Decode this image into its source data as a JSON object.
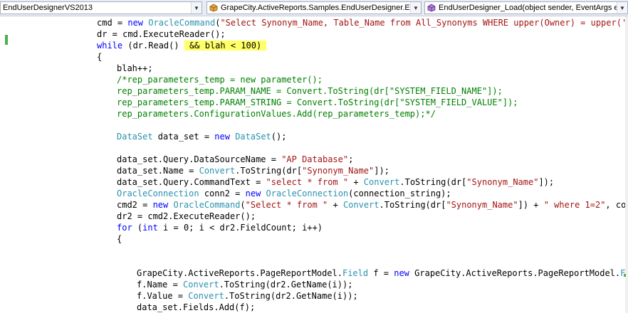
{
  "navigation_bar": {
    "project": "EndUserDesignerVS2013",
    "type": "GrapeCity.ActiveReports.Samples.EndUserDesigner.En",
    "member": "EndUserDesigner_Load(object sender, EventArgs e)"
  },
  "colors": {
    "keyword": "#0000ff",
    "type": "#2b91af",
    "string": "#a31515",
    "comment": "#008000",
    "highlight": "#ffff66",
    "change_marker": "#4cb050"
  },
  "icons": [
    "class-icon",
    "method-icon",
    "chevron-down-icon"
  ],
  "code_lines": [
    {
      "indent": 0,
      "tokens": [
        {
          "t": "cmd = "
        },
        {
          "t": "new",
          "c": "kw"
        },
        {
          "t": " "
        },
        {
          "t": "OracleCommand",
          "c": "ty"
        },
        {
          "t": "("
        },
        {
          "t": "\"Select Synonym_Name, Table_Name from All_Synonyms WHERE upper(Owner) = upper('\"",
          "c": "st"
        },
        {
          "t": " +"
        }
      ]
    },
    {
      "indent": 0,
      "tokens": [
        {
          "t": "dr = cmd.ExecuteReader();"
        }
      ]
    },
    {
      "indent": 0,
      "tokens": [
        {
          "t": "while",
          "c": "kw"
        },
        {
          "t": " (dr.Read() "
        },
        {
          "t": " && blah < 100) ",
          "c": "hl"
        }
      ]
    },
    {
      "indent": 0,
      "tokens": [
        {
          "t": "{"
        }
      ]
    },
    {
      "indent": 1,
      "tokens": [
        {
          "t": "blah++;"
        }
      ]
    },
    {
      "indent": 1,
      "tokens": [
        {
          "t": "/*rep_parameters_temp = new parameter();",
          "c": "cm"
        }
      ]
    },
    {
      "indent": 1,
      "tokens": [
        {
          "t": "rep_parameters_temp.PARAM_NAME = Convert.ToString(dr[\"SYSTEM_FIELD_NAME\"]);",
          "c": "cm"
        }
      ]
    },
    {
      "indent": 1,
      "tokens": [
        {
          "t": "rep_parameters_temp.PARAM_STRING = Convert.ToString(dr[\"SYSTEM_FIELD_VALUE\"]);",
          "c": "cm"
        }
      ]
    },
    {
      "indent": 1,
      "tokens": [
        {
          "t": "rep_parameters.ConfigurationValues.Add(rep_parameters_temp);*/",
          "c": "cm"
        }
      ]
    },
    {
      "indent": 1,
      "tokens": []
    },
    {
      "indent": 1,
      "tokens": [
        {
          "t": "DataSet",
          "c": "ty"
        },
        {
          "t": " data_set = "
        },
        {
          "t": "new",
          "c": "kw"
        },
        {
          "t": " "
        },
        {
          "t": "DataSet",
          "c": "ty"
        },
        {
          "t": "();"
        }
      ]
    },
    {
      "indent": 1,
      "tokens": []
    },
    {
      "indent": 1,
      "tokens": [
        {
          "t": "data_set.Query.DataSourceName = "
        },
        {
          "t": "\"AP Database\"",
          "c": "st"
        },
        {
          "t": ";"
        }
      ]
    },
    {
      "indent": 1,
      "tokens": [
        {
          "t": "data_set.Name = "
        },
        {
          "t": "Convert",
          "c": "ty"
        },
        {
          "t": ".ToString(dr["
        },
        {
          "t": "\"Synonym_Name\"",
          "c": "st"
        },
        {
          "t": "]);"
        }
      ]
    },
    {
      "indent": 1,
      "tokens": [
        {
          "t": "data_set.Query.CommandText = "
        },
        {
          "t": "\"select * from \"",
          "c": "st"
        },
        {
          "t": " + "
        },
        {
          "t": "Convert",
          "c": "ty"
        },
        {
          "t": ".ToString(dr["
        },
        {
          "t": "\"Synonym_Name\"",
          "c": "st"
        },
        {
          "t": "]);"
        }
      ]
    },
    {
      "indent": 1,
      "tokens": [
        {
          "t": "OracleConnection",
          "c": "ty"
        },
        {
          "t": " conn2 = "
        },
        {
          "t": "new",
          "c": "kw"
        },
        {
          "t": " "
        },
        {
          "t": "OracleConnection",
          "c": "ty"
        },
        {
          "t": "(connection_string);"
        }
      ]
    },
    {
      "indent": 1,
      "tokens": [
        {
          "t": "cmd2 = "
        },
        {
          "t": "new",
          "c": "kw"
        },
        {
          "t": " "
        },
        {
          "t": "OracleCommand",
          "c": "ty"
        },
        {
          "t": "("
        },
        {
          "t": "\"Select * from \"",
          "c": "st"
        },
        {
          "t": " + "
        },
        {
          "t": "Convert",
          "c": "ty"
        },
        {
          "t": ".ToString(dr["
        },
        {
          "t": "\"Synonym_Name\"",
          "c": "st"
        },
        {
          "t": "]) + "
        },
        {
          "t": "\" where 1=2\"",
          "c": "st"
        },
        {
          "t": ", conn)"
        }
      ]
    },
    {
      "indent": 1,
      "tokens": [
        {
          "t": "dr2 = cmd2.ExecuteReader();"
        }
      ]
    },
    {
      "indent": 1,
      "tokens": [
        {
          "t": "for",
          "c": "kw"
        },
        {
          "t": " ("
        },
        {
          "t": "int",
          "c": "kw"
        },
        {
          "t": " i = 0; i < dr2.FieldCount; i++)"
        }
      ]
    },
    {
      "indent": 1,
      "tokens": [
        {
          "t": "{"
        }
      ]
    },
    {
      "indent": 1,
      "tokens": []
    },
    {
      "indent": 1,
      "tokens": []
    },
    {
      "indent": 2,
      "tokens": [
        {
          "t": "GrapeCity.ActiveReports.PageReportModel."
        },
        {
          "t": "Field",
          "c": "ty"
        },
        {
          "t": " f = "
        },
        {
          "t": "new",
          "c": "kw"
        },
        {
          "t": " GrapeCity.ActiveReports.PageReportModel."
        },
        {
          "t": "Fiel",
          "c": "ty"
        }
      ]
    },
    {
      "indent": 2,
      "tokens": [
        {
          "t": "f.Name = "
        },
        {
          "t": "Convert",
          "c": "ty"
        },
        {
          "t": ".ToString(dr2.GetName(i));"
        }
      ]
    },
    {
      "indent": 2,
      "tokens": [
        {
          "t": "f.Value = "
        },
        {
          "t": "Convert",
          "c": "ty"
        },
        {
          "t": ".ToString(dr2.GetName(i));"
        }
      ]
    },
    {
      "indent": 2,
      "tokens": [
        {
          "t": "data_set.Fields.Add(f);"
        }
      ]
    }
  ]
}
